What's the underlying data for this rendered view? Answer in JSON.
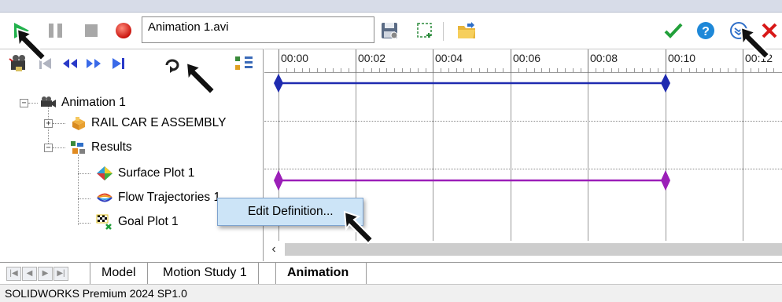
{
  "toolbar": {
    "play_icon": "play-icon",
    "pause_icon": "pause-icon",
    "stop_icon": "stop-icon",
    "record_icon": "record-icon",
    "filename_value": "Animation 1.avi",
    "save_icon": "save-icon",
    "select_area_icon": "select-area-icon",
    "open_folder_icon": "open-folder-icon",
    "ok_icon": "checkmark-icon",
    "help_icon": "help-icon",
    "collapse_icon": "collapse-icon",
    "close_icon": "close-icon"
  },
  "panel_toolbar": [
    "camera-icon",
    "go-to-start-icon",
    "step-back-icon",
    "step-forward-icon",
    "go-to-end-icon",
    "loop-icon",
    "tree-options-icon"
  ],
  "tree": {
    "root": "Animation 1",
    "assembly": "RAIL CAR E ASSEMBLY",
    "results": "Results",
    "surface_plot": "Surface Plot 1",
    "flow_trajectories": "Flow Trajectories 1",
    "goal_plot": "Goal Plot 1"
  },
  "timeline": {
    "ticks": [
      "00:00",
      "00:02",
      "00:04",
      "00:06",
      "00:08",
      "00:10",
      "00:12"
    ],
    "tracks": [
      {
        "color": "#1f2bb0",
        "start": "00:00",
        "end": "00:10"
      },
      {
        "color": "#9b1fb8",
        "start": "00:00",
        "end": "00:10"
      }
    ]
  },
  "context_menu": {
    "edit_definition": "Edit Definition..."
  },
  "tabs": {
    "model": "Model",
    "motion_study": "Motion Study 1",
    "animation": "Animation"
  },
  "status": {
    "text": "SOLIDWORKS Premium 2024 SP1.0"
  },
  "colors": {
    "accent_play": "#22b14c",
    "record": "#e01e1e",
    "track_blue": "#1f2bb0",
    "track_purple": "#9b1fb8",
    "menu_highlight": "#cce4f7"
  }
}
